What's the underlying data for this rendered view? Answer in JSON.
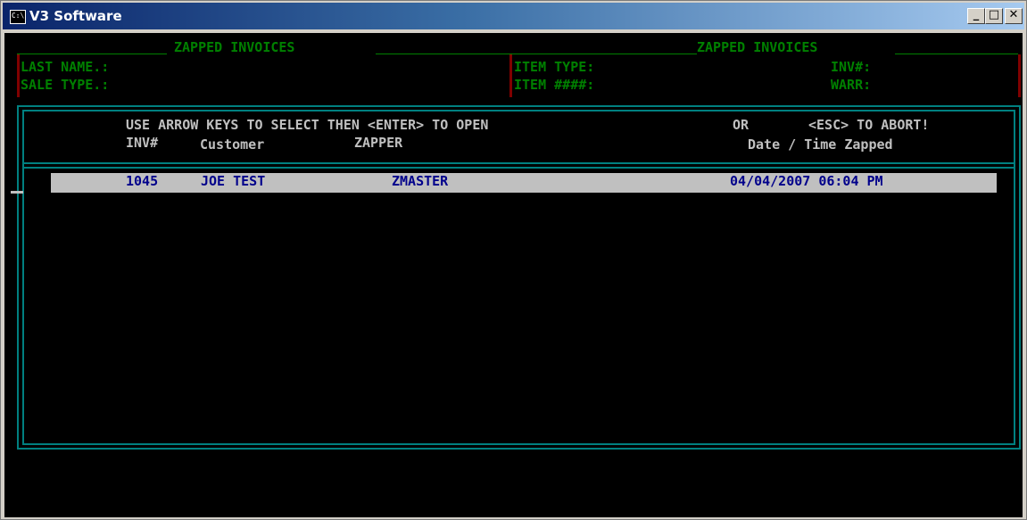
{
  "window": {
    "title": "V3 Software",
    "icon_name": "console-icon",
    "icon_text": "C:\\",
    "controls": {
      "minimize": "_",
      "maximize": "□",
      "close": "✕"
    }
  },
  "header": {
    "left_title": "ZAPPED INVOICES",
    "right_title": "ZAPPED INVOICES",
    "last_name_label": "LAST NAME.:",
    "sale_type_label": "SALE TYPE.:",
    "item_type_label": "ITEM TYPE:",
    "item_num_label": "ITEM ####:",
    "inv_label": "INV#:",
    "warr_label": "WARR:"
  },
  "list": {
    "instruction": "USE ARROW KEYS TO SELECT THEN <ENTER> TO OPEN",
    "or_text": "OR",
    "esc_text": "<ESC> TO ABORT!",
    "columns": {
      "inv": "INV#",
      "customer": "Customer",
      "zapper": "ZAPPER",
      "date_time": "Date / Time Zapped"
    },
    "rows": [
      {
        "inv": "1045",
        "customer": "JOE TEST",
        "zapper": "ZMASTER",
        "date_time": "04/04/2007 06:04 PM"
      }
    ]
  },
  "colors": {
    "green": "#008000",
    "maroon": "#800000",
    "teal": "#008080",
    "selection_bg": "#c0c0c0",
    "selection_text": "#00008b"
  }
}
